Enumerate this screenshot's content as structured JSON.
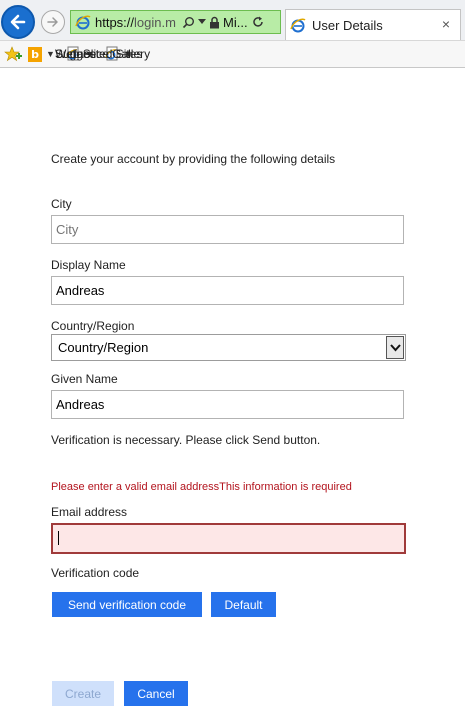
{
  "browser": {
    "url_scheme": "https://",
    "url_host": "login.m",
    "site_label": "Mi...",
    "tab_title": "User Details",
    "tab_close": "×",
    "favorites": [
      {
        "label": "Suggested Sites",
        "icon": "bing-icon"
      },
      {
        "label": "Surface",
        "icon": "ie-icon"
      },
      {
        "label": "Web Slice Gallery",
        "icon": "ie-icon"
      }
    ],
    "colors": {
      "address_bar": "#b8eca6",
      "back_button": "#1a6fcf"
    }
  },
  "form": {
    "intro": "Create your account by providing the following details",
    "city": {
      "label": "City",
      "placeholder": "City"
    },
    "display_name": {
      "label": "Display Name",
      "value": "Andreas"
    },
    "country": {
      "label": "Country/Region",
      "selected": "Country/Region"
    },
    "given_name": {
      "label": "Given Name",
      "value": "Andreas"
    },
    "verification_note": "Verification is necessary. Please click Send button.",
    "error": "Please enter a valid email addressThis information is required",
    "email": {
      "label": "Email address",
      "value": ""
    },
    "verification_code_label": "Verification code",
    "send_code_label": "Send verification code",
    "default_label": "Default",
    "create_label": "Create",
    "cancel_label": "Cancel",
    "colors": {
      "primary_button": "#2672ec",
      "error_text": "#b3141e",
      "error_field_bg": "#fde7e7"
    }
  }
}
